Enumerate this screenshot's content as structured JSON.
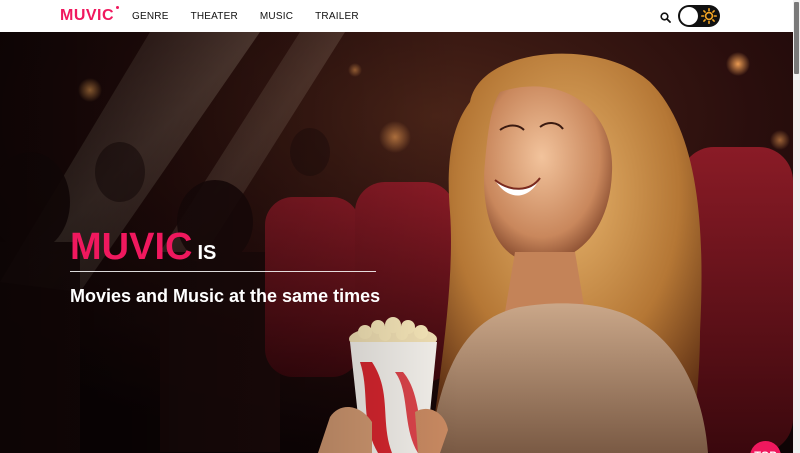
{
  "header": {
    "logo": "MUVIC",
    "nav": [
      {
        "label": "GENRE"
      },
      {
        "label": "THEATER"
      },
      {
        "label": "MUSIC"
      },
      {
        "label": "TRAILER"
      }
    ],
    "search_icon": "search-icon",
    "theme_toggle": {
      "icon": "sun-icon",
      "state": "light"
    }
  },
  "hero": {
    "brand": "MUVIC",
    "brand_suffix": "IS",
    "tagline": "Movies and Music at the same times",
    "image": "woman-in-cinema-with-popcorn"
  },
  "top_button": {
    "label": "TOP"
  },
  "colors": {
    "accent": "#f0185e",
    "header_bg": "#ffffff",
    "text_dark": "#111111",
    "hero_text": "#ffffff"
  }
}
